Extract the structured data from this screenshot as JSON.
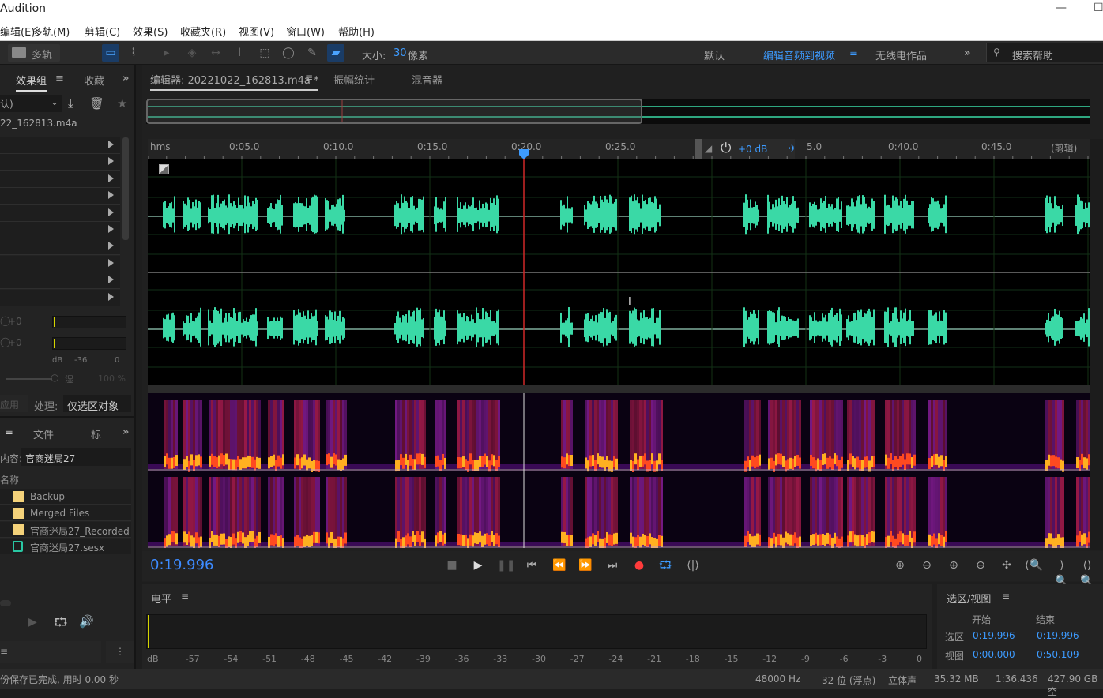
{
  "window": {
    "title": "Audition",
    "minimize": "—",
    "maximize": "☐"
  },
  "menu": [
    "编辑(E)",
    "多轨(M)",
    "剪辑(C)",
    "效果(S)",
    "收藏夹(R)",
    "视图(V)",
    "窗口(W)",
    "帮助(H)"
  ],
  "toolbar": {
    "multitrack_label": "多轨",
    "size_label": "大小:",
    "size_value": "30",
    "size_unit": "像素",
    "workspaces": [
      "默认",
      "编辑音频到视频",
      "无线电作品"
    ],
    "active_workspace": "编辑音频到视频",
    "overflow": "»",
    "search_placeholder": "搜索帮助"
  },
  "left_panel": {
    "tabs": [
      "效果组",
      "收藏"
    ],
    "preset_value": "认)",
    "file_label": "22_162813.m4a",
    "effect_slots": 10,
    "input_gain": "+0",
    "output_gain": "+0",
    "meter_scale": [
      "dB",
      "-36",
      "0"
    ],
    "mix_label": "湿",
    "mix_value": "100 %",
    "apply_label": "应用",
    "process_label": "处理:",
    "process_value": "仅选区对象",
    "files_tabs": [
      "文件",
      "标"
    ],
    "content_label": "内容:",
    "content_value": "官商迷局27",
    "name_header": "名称",
    "files": [
      {
        "name": "Backup",
        "type": "folder"
      },
      {
        "name": "Merged Files",
        "type": "folder"
      },
      {
        "name": "官商迷局27_Recorded",
        "type": "folder"
      },
      {
        "name": "官商迷局27.sesx",
        "type": "session"
      }
    ]
  },
  "editor": {
    "tabs": [
      "编辑器: 20221022_162813.m4a *",
      "振幅统计",
      "混音器"
    ],
    "ruler_unit": "hms",
    "ruler_labels": [
      "0:05.0",
      "0:10.0",
      "0:15.0",
      "0:20.0",
      "0:25.0",
      "5.0",
      "0:40.0",
      "0:45.0"
    ],
    "ruler_end": "(剪辑)",
    "hud_gain": "+0 dB",
    "playhead_time": "0:19.996",
    "total_view": "0:50.109"
  },
  "transport": {
    "timecode": "0:19.996",
    "buttons": [
      "stop",
      "play",
      "pause",
      "go-to-start",
      "rewind",
      "fast-forward",
      "go-to-end",
      "record",
      "loop",
      "skip-selection"
    ],
    "zoom_buttons": [
      "zoom-in-amplitude",
      "zoom-out-amplitude",
      "zoom-in-time",
      "zoom-out-time",
      "zoom-selection",
      "zoom-in-point",
      "zoom-out-point",
      "zoom-full"
    ]
  },
  "levels": {
    "title": "电平",
    "scale": [
      "dB",
      "-57",
      "-54",
      "-51",
      "-48",
      "-45",
      "-42",
      "-39",
      "-36",
      "-33",
      "-30",
      "-27",
      "-24",
      "-21",
      "-18",
      "-15",
      "-12",
      "-9",
      "-6",
      "-3",
      "0"
    ]
  },
  "selection_view": {
    "title": "选区/视图",
    "headers": [
      "开始",
      "结束"
    ],
    "rows": [
      {
        "label": "选区",
        "start": "0:19.996",
        "end": "0:19.996"
      },
      {
        "label": "视图",
        "start": "0:00.000",
        "end": "0:50.109"
      }
    ]
  },
  "status": {
    "message": "份保存已完成, 用时 0.00 秒",
    "sample_rate": "48000 Hz",
    "bit_depth": "32 位 (浮点)",
    "channels": "立体声",
    "file_size": "35.32 MB",
    "duration": "1:36.436",
    "free_space": "427.90 GB 空"
  },
  "colors": {
    "accent": "#3d9bff",
    "waveform": "#3ad9a6",
    "playhead": "#d02828",
    "record": "#ff3b3b"
  }
}
